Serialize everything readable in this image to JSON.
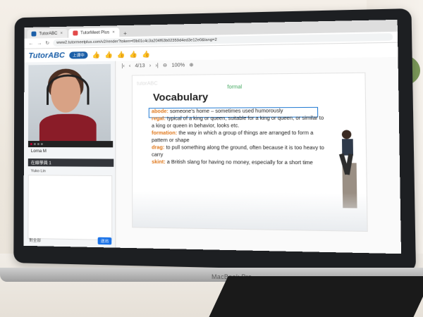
{
  "browser": {
    "tabs": [
      {
        "label": "TutorABC",
        "active": false
      },
      {
        "label": "TutorMeet Plus",
        "active": true
      }
    ],
    "url": "www2.tutormeetplus.com/v2/render?token=f3b01c4c3a204f63b02359d4ed3e12e0&lang=2"
  },
  "app": {
    "logo": "TutorABC",
    "status_label": "上课中",
    "accent": "#1b5fa8",
    "reactions": [
      "thumbs-up-icon",
      "thumbs-up-icon",
      "thumbs-up-icon",
      "thumbs-up-icon",
      "thumbs-up-icon"
    ]
  },
  "left_panel": {
    "participant_name": "Lorna M",
    "group_title": "在線學員 1",
    "student_name": "Yuko Lin",
    "chat_target": "對全部",
    "send_label": "送出"
  },
  "slide": {
    "page_indicator": "4/13",
    "zoom": "100%",
    "faded_text": "tutorABC",
    "title": "Vocabulary",
    "tag": "formal",
    "entries": [
      {
        "term": "abode:",
        "definition": "someone's home – sometimes used humorously"
      },
      {
        "term": "regal:",
        "definition": "typical of a king or queen, suitable for a king or queen, or similar to a king or queen in behavior, looks etc."
      },
      {
        "term": "formation:",
        "definition": "the way in which a group of things are arranged to form a pattern or shape"
      },
      {
        "term": "drag:",
        "definition": "to pull something along the ground, often because it is too heavy to carry"
      },
      {
        "term": "skint:",
        "definition": "a British slang for having no money, especially for a short time"
      }
    ]
  },
  "device": {
    "label": "MacBook Pro"
  }
}
